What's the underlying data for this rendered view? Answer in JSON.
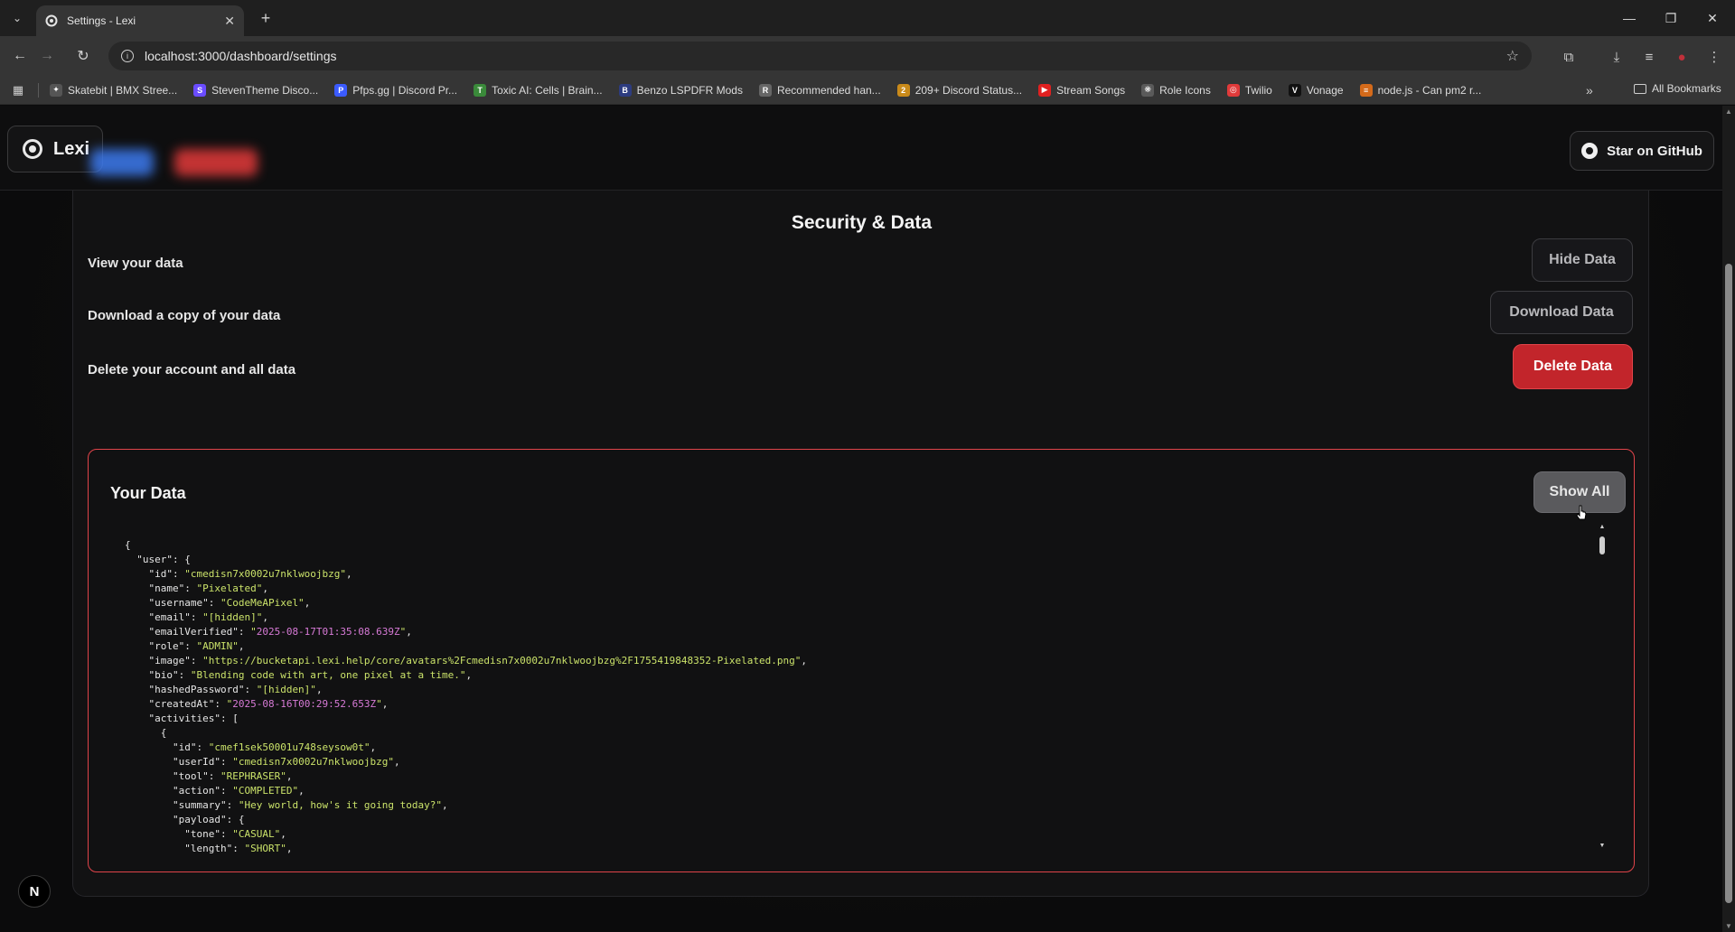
{
  "browser": {
    "tab_title": "Settings - Lexi",
    "url": "localhost:3000/dashboard/settings",
    "bookmarks": [
      {
        "label": "Skatebit | BMX Stree...",
        "color": "#555555",
        "glyph": "✦"
      },
      {
        "label": "StevenTheme Disco...",
        "color": "#6a4cff",
        "glyph": "S"
      },
      {
        "label": "Pfps.gg | Discord Pr...",
        "color": "#3b5bff",
        "glyph": "P"
      },
      {
        "label": "Toxic AI: Cells | Brain...",
        "color": "#3a8a3a",
        "glyph": "T"
      },
      {
        "label": "Benzo LSPDFR Mods",
        "color": "#2d3c80",
        "glyph": "B"
      },
      {
        "label": "Recommended han...",
        "color": "#666666",
        "glyph": "R"
      },
      {
        "label": "209+ Discord Status...",
        "color": "#c98a1a",
        "glyph": "2"
      },
      {
        "label": "Stream Songs",
        "color": "#e02020",
        "glyph": "▶"
      },
      {
        "label": "Role Icons",
        "color": "#5a5a5a",
        "glyph": "❋"
      },
      {
        "label": "Twilio",
        "color": "#e03a3a",
        "glyph": "◎"
      },
      {
        "label": "Vonage",
        "color": "#111111",
        "glyph": "V"
      },
      {
        "label": "node.js - Can pm2 r...",
        "color": "#d46a1a",
        "glyph": "≡"
      }
    ],
    "all_bookmarks": "All Bookmarks"
  },
  "header": {
    "brand": "Lexi",
    "github_button": "Star on GitHub"
  },
  "security": {
    "title": "Security & Data",
    "rows": [
      {
        "label": "View your data",
        "button": "Hide Data"
      },
      {
        "label": "Download a copy of your data",
        "button": "Download Data"
      },
      {
        "label": "Delete your account and all data",
        "button": "Delete Data"
      }
    ]
  },
  "your_data": {
    "title": "Your Data",
    "show_all": "Show All",
    "lines": [
      [
        [
          "k",
          "{"
        ]
      ],
      [
        [
          "k",
          "  \"user\": {"
        ]
      ],
      [
        [
          "k",
          "    \"id\": "
        ],
        [
          "s",
          "\"cmedisn7x0002u7nklwoojbzg\""
        ],
        [
          "k",
          ","
        ]
      ],
      [
        [
          "k",
          "    \"name\": "
        ],
        [
          "s",
          "\"Pixelated\""
        ],
        [
          "k",
          ","
        ]
      ],
      [
        [
          "k",
          "    \"username\": "
        ],
        [
          "s",
          "\"CodeMeAPixel\""
        ],
        [
          "k",
          ","
        ]
      ],
      [
        [
          "k",
          "    \"email\": "
        ],
        [
          "s",
          "\"[hidden]\""
        ],
        [
          "k",
          ","
        ]
      ],
      [
        [
          "k",
          "    \"emailVerified\": "
        ],
        [
          "s",
          "\""
        ],
        [
          "d",
          "2025-08-17T01:35:08.639Z"
        ],
        [
          "s",
          "\""
        ],
        [
          "k",
          ","
        ]
      ],
      [
        [
          "k",
          "    \"role\": "
        ],
        [
          "s",
          "\"ADMIN\""
        ],
        [
          "k",
          ","
        ]
      ],
      [
        [
          "k",
          "    \"image\": "
        ],
        [
          "s",
          "\"https://bucketapi.lexi.help/core/avatars%2Fcmedisn7x0002u7nklwoojbzg%2F1755419848352-Pixelated.png\""
        ],
        [
          "k",
          ","
        ]
      ],
      [
        [
          "k",
          "    \"bio\": "
        ],
        [
          "s",
          "\"Blending code with art, one pixel at a time.\""
        ],
        [
          "k",
          ","
        ]
      ],
      [
        [
          "k",
          "    \"hashedPassword\": "
        ],
        [
          "s",
          "\"[hidden]\""
        ],
        [
          "k",
          ","
        ]
      ],
      [
        [
          "k",
          "    \"createdAt\": "
        ],
        [
          "s",
          "\""
        ],
        [
          "d",
          "2025-08-16T00:29:52.653Z"
        ],
        [
          "s",
          "\""
        ],
        [
          "k",
          ","
        ]
      ],
      [
        [
          "k",
          "    \"activities\": ["
        ]
      ],
      [
        [
          "k",
          "      {"
        ]
      ],
      [
        [
          "k",
          "        \"id\": "
        ],
        [
          "s",
          "\"cmef1sek50001u748seysow0t\""
        ],
        [
          "k",
          ","
        ]
      ],
      [
        [
          "k",
          "        \"userId\": "
        ],
        [
          "s",
          "\"cmedisn7x0002u7nklwoojbzg\""
        ],
        [
          "k",
          ","
        ]
      ],
      [
        [
          "k",
          "        \"tool\": "
        ],
        [
          "s",
          "\"REPHRASER\""
        ],
        [
          "k",
          ","
        ]
      ],
      [
        [
          "k",
          "        \"action\": "
        ],
        [
          "s",
          "\"COMPLETED\""
        ],
        [
          "k",
          ","
        ]
      ],
      [
        [
          "k",
          "        \"summary\": "
        ],
        [
          "s",
          "\"Hey world, how's it going today?\""
        ],
        [
          "k",
          ","
        ]
      ],
      [
        [
          "k",
          "        \"payload\": {"
        ]
      ],
      [
        [
          "k",
          "          \"tone\": "
        ],
        [
          "s",
          "\"CASUAL\""
        ],
        [
          "k",
          ","
        ]
      ],
      [
        [
          "k",
          "          \"length\": "
        ],
        [
          "s",
          "\"SHORT\""
        ],
        [
          "k",
          ","
        ]
      ]
    ]
  },
  "next_badge": "N"
}
